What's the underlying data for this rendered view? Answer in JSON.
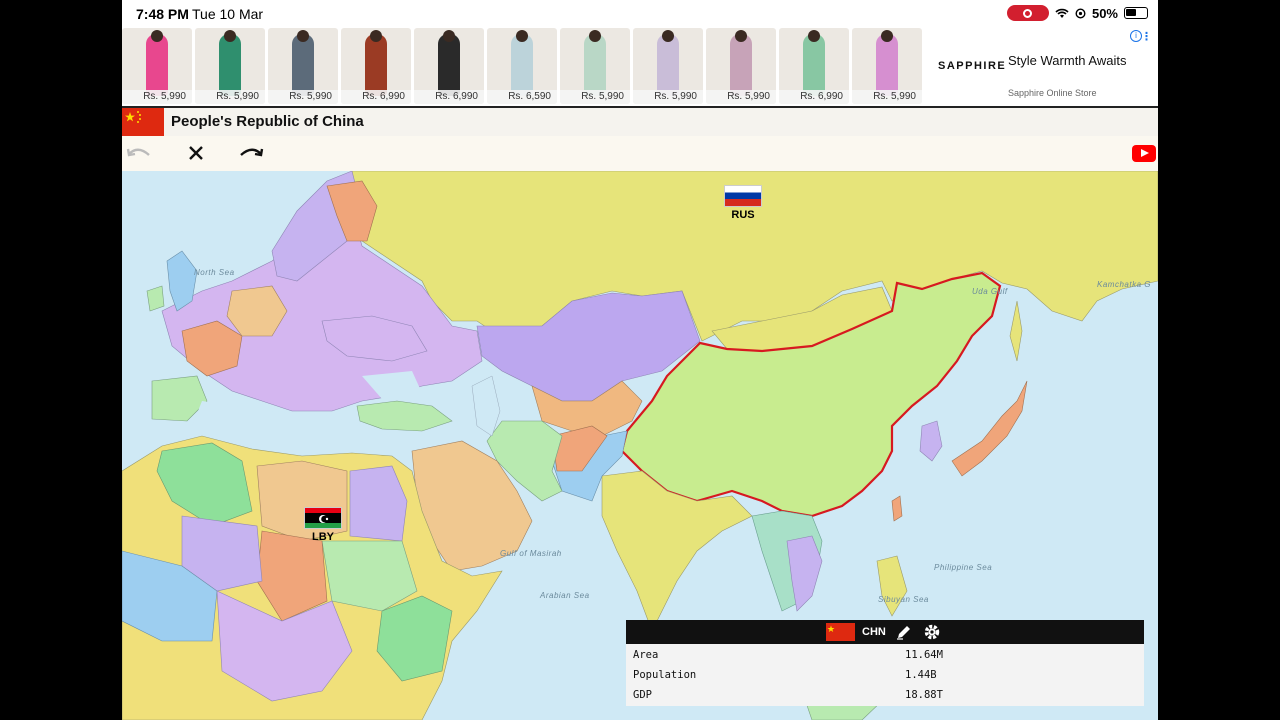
{
  "status_bar": {
    "time": "7:48 PM",
    "date": "Tue 10 Mar",
    "battery": "50%"
  },
  "ad": {
    "prices": [
      "Rs. 5,990",
      "Rs. 5,990",
      "Rs. 5,990",
      "Rs. 6,990",
      "Rs. 6,990",
      "Rs. 6,590",
      "Rs. 5,990",
      "Rs. 5,990",
      "Rs. 5,990",
      "Rs. 6,990",
      "Rs. 5,990"
    ],
    "product_colors": [
      "#e8478e",
      "#2f8f6e",
      "#5c6b7a",
      "#9b3b24",
      "#2a2a2a",
      "#bcd3da",
      "#b9d7c6",
      "#c9bdd8",
      "#c7a3b8",
      "#88c7a3",
      "#d68fd0"
    ],
    "brand": "SAPPHIRE",
    "title": "Style Warmth Awaits",
    "subtitle": "Sapphire Online Store",
    "info_icon": "i",
    "menu_icon": "⋮"
  },
  "header": {
    "title": "People's Republic of China",
    "flag_color": "#de2910"
  },
  "map": {
    "sea_labels": {
      "north_sea": "North Sea",
      "gulf_of_masirah": "Gulf of Masirah",
      "arabian_sea": "Arabian Sea",
      "philippine_sea": "Philippine Sea",
      "sibuyan_sea": "Sibuyan Sea",
      "kamchatka": "Kamchatka G",
      "uda_gulf": "Uda Gulf"
    },
    "markers": {
      "russia": "RUS",
      "libya": "LBY"
    },
    "highlight_color": "#d71920"
  },
  "panel": {
    "code": "CHN",
    "rows": [
      {
        "label": "Area",
        "value": "11.64M"
      },
      {
        "label": "Population",
        "value": "1.44B"
      },
      {
        "label": "GDP",
        "value": "18.88T"
      }
    ]
  }
}
